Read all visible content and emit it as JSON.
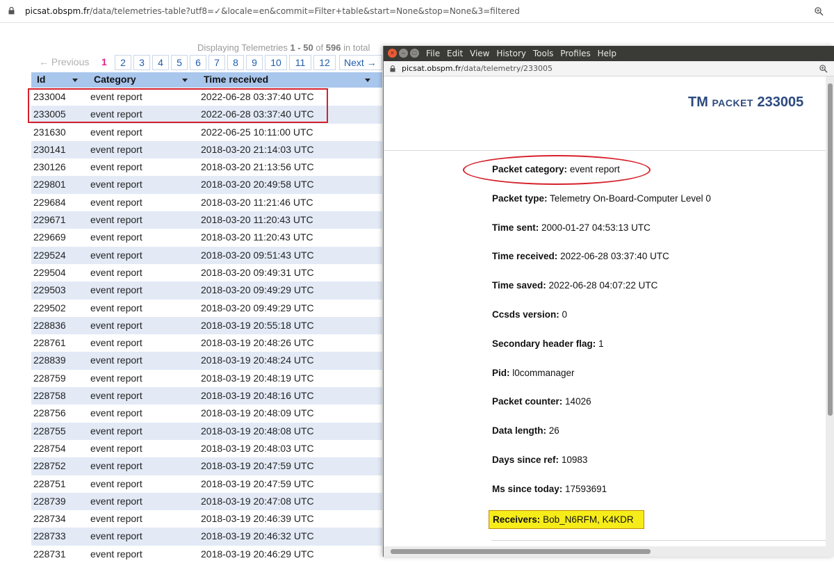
{
  "main_browser": {
    "url_host": "picsat.obspm.fr",
    "url_path": "/data/telemetries-table?utf8=✓&locale=en&commit=Filter+table&start=None&stop=None&3=filtered"
  },
  "listing": {
    "display_prefix": "Displaying Telemetries ",
    "display_range": "1 - 50",
    "display_of": " of ",
    "display_total": "596",
    "display_suffix": " in total",
    "pagination": {
      "previous": "← Previous",
      "current": "1",
      "pages": [
        "2",
        "3",
        "4",
        "5",
        "6",
        "7",
        "8",
        "9",
        "10",
        "11",
        "12"
      ],
      "next": "Next →"
    },
    "columns": [
      "Id",
      "Category",
      "Time received"
    ],
    "rows": [
      [
        "233004",
        "event report",
        "2022-06-28 03:37:40 UTC"
      ],
      [
        "233005",
        "event report",
        "2022-06-28 03:37:40 UTC"
      ],
      [
        "231630",
        "event report",
        "2022-06-25 10:11:00 UTC"
      ],
      [
        "230141",
        "event report",
        "2018-03-20 21:14:03 UTC"
      ],
      [
        "230126",
        "event report",
        "2018-03-20 21:13:56 UTC"
      ],
      [
        "229801",
        "event report",
        "2018-03-20 20:49:58 UTC"
      ],
      [
        "229684",
        "event report",
        "2018-03-20 11:21:46 UTC"
      ],
      [
        "229671",
        "event report",
        "2018-03-20 11:20:43 UTC"
      ],
      [
        "229669",
        "event report",
        "2018-03-20 11:20:43 UTC"
      ],
      [
        "229524",
        "event report",
        "2018-03-20 09:51:43 UTC"
      ],
      [
        "229504",
        "event report",
        "2018-03-20 09:49:31 UTC"
      ],
      [
        "229503",
        "event report",
        "2018-03-20 09:49:29 UTC"
      ],
      [
        "229502",
        "event report",
        "2018-03-20 09:49:29 UTC"
      ],
      [
        "228836",
        "event report",
        "2018-03-19 20:55:18 UTC"
      ],
      [
        "228761",
        "event report",
        "2018-03-19 20:48:26 UTC"
      ],
      [
        "228839",
        "event report",
        "2018-03-19 20:48:24 UTC"
      ],
      [
        "228759",
        "event report",
        "2018-03-19 20:48:19 UTC"
      ],
      [
        "228758",
        "event report",
        "2018-03-19 20:48:16 UTC"
      ],
      [
        "228756",
        "event report",
        "2018-03-19 20:48:09 UTC"
      ],
      [
        "228755",
        "event report",
        "2018-03-19 20:48:08 UTC"
      ],
      [
        "228754",
        "event report",
        "2018-03-19 20:48:03 UTC"
      ],
      [
        "228752",
        "event report",
        "2018-03-19 20:47:59 UTC"
      ],
      [
        "228751",
        "event report",
        "2018-03-19 20:47:59 UTC"
      ],
      [
        "228739",
        "event report",
        "2018-03-19 20:47:08 UTC"
      ],
      [
        "228734",
        "event report",
        "2018-03-19 20:46:39 UTC"
      ],
      [
        "228733",
        "event report",
        "2018-03-19 20:46:32 UTC"
      ],
      [
        "228731",
        "event report",
        "2018-03-19 20:46:29 UTC"
      ]
    ]
  },
  "popup": {
    "menu": [
      "File",
      "Edit",
      "View",
      "History",
      "Tools",
      "Profiles",
      "Help"
    ],
    "url_host": "picsat.obspm.fr",
    "url_path": "/data/telemetry/233005",
    "title_tm": "TM ",
    "title_packet": "PACKET",
    "title_id": " 233005",
    "fields": [
      {
        "label": "Packet category:",
        "value": " event report"
      },
      {
        "label": "Packet type:",
        "value": " Telemetry On-Board-Computer Level 0"
      },
      {
        "label": "Time sent:",
        "value": " 2000-01-27 04:53:13 UTC"
      },
      {
        "label": "Time received:",
        "value": " 2022-06-28 03:37:40 UTC"
      },
      {
        "label": "Time saved:",
        "value": " 2022-06-28 04:07:22 UTC"
      },
      {
        "label": "Ccsds version:",
        "value": " 0"
      },
      {
        "label": "Secondary header flag:",
        "value": " 1"
      },
      {
        "label": "Pid:",
        "value": " l0commanager"
      },
      {
        "label": "Packet counter:",
        "value": " 14026"
      },
      {
        "label": "Data length:",
        "value": " 26"
      },
      {
        "label": "Days since ref:",
        "value": " 10983"
      },
      {
        "label": "Ms since today:",
        "value": " 17593691"
      }
    ],
    "receivers": {
      "label": "Receivers:",
      "value": " Bob_N6RFM, K4KDR"
    }
  },
  "colors": {
    "table_header": "#a9c6ec",
    "row_alt": "#e3eaf6",
    "annotation_red": "#d6202a",
    "highlight_yellow": "#f6ec19",
    "title_blue": "#2b4a7e",
    "link_blue": "#1e5db0"
  }
}
